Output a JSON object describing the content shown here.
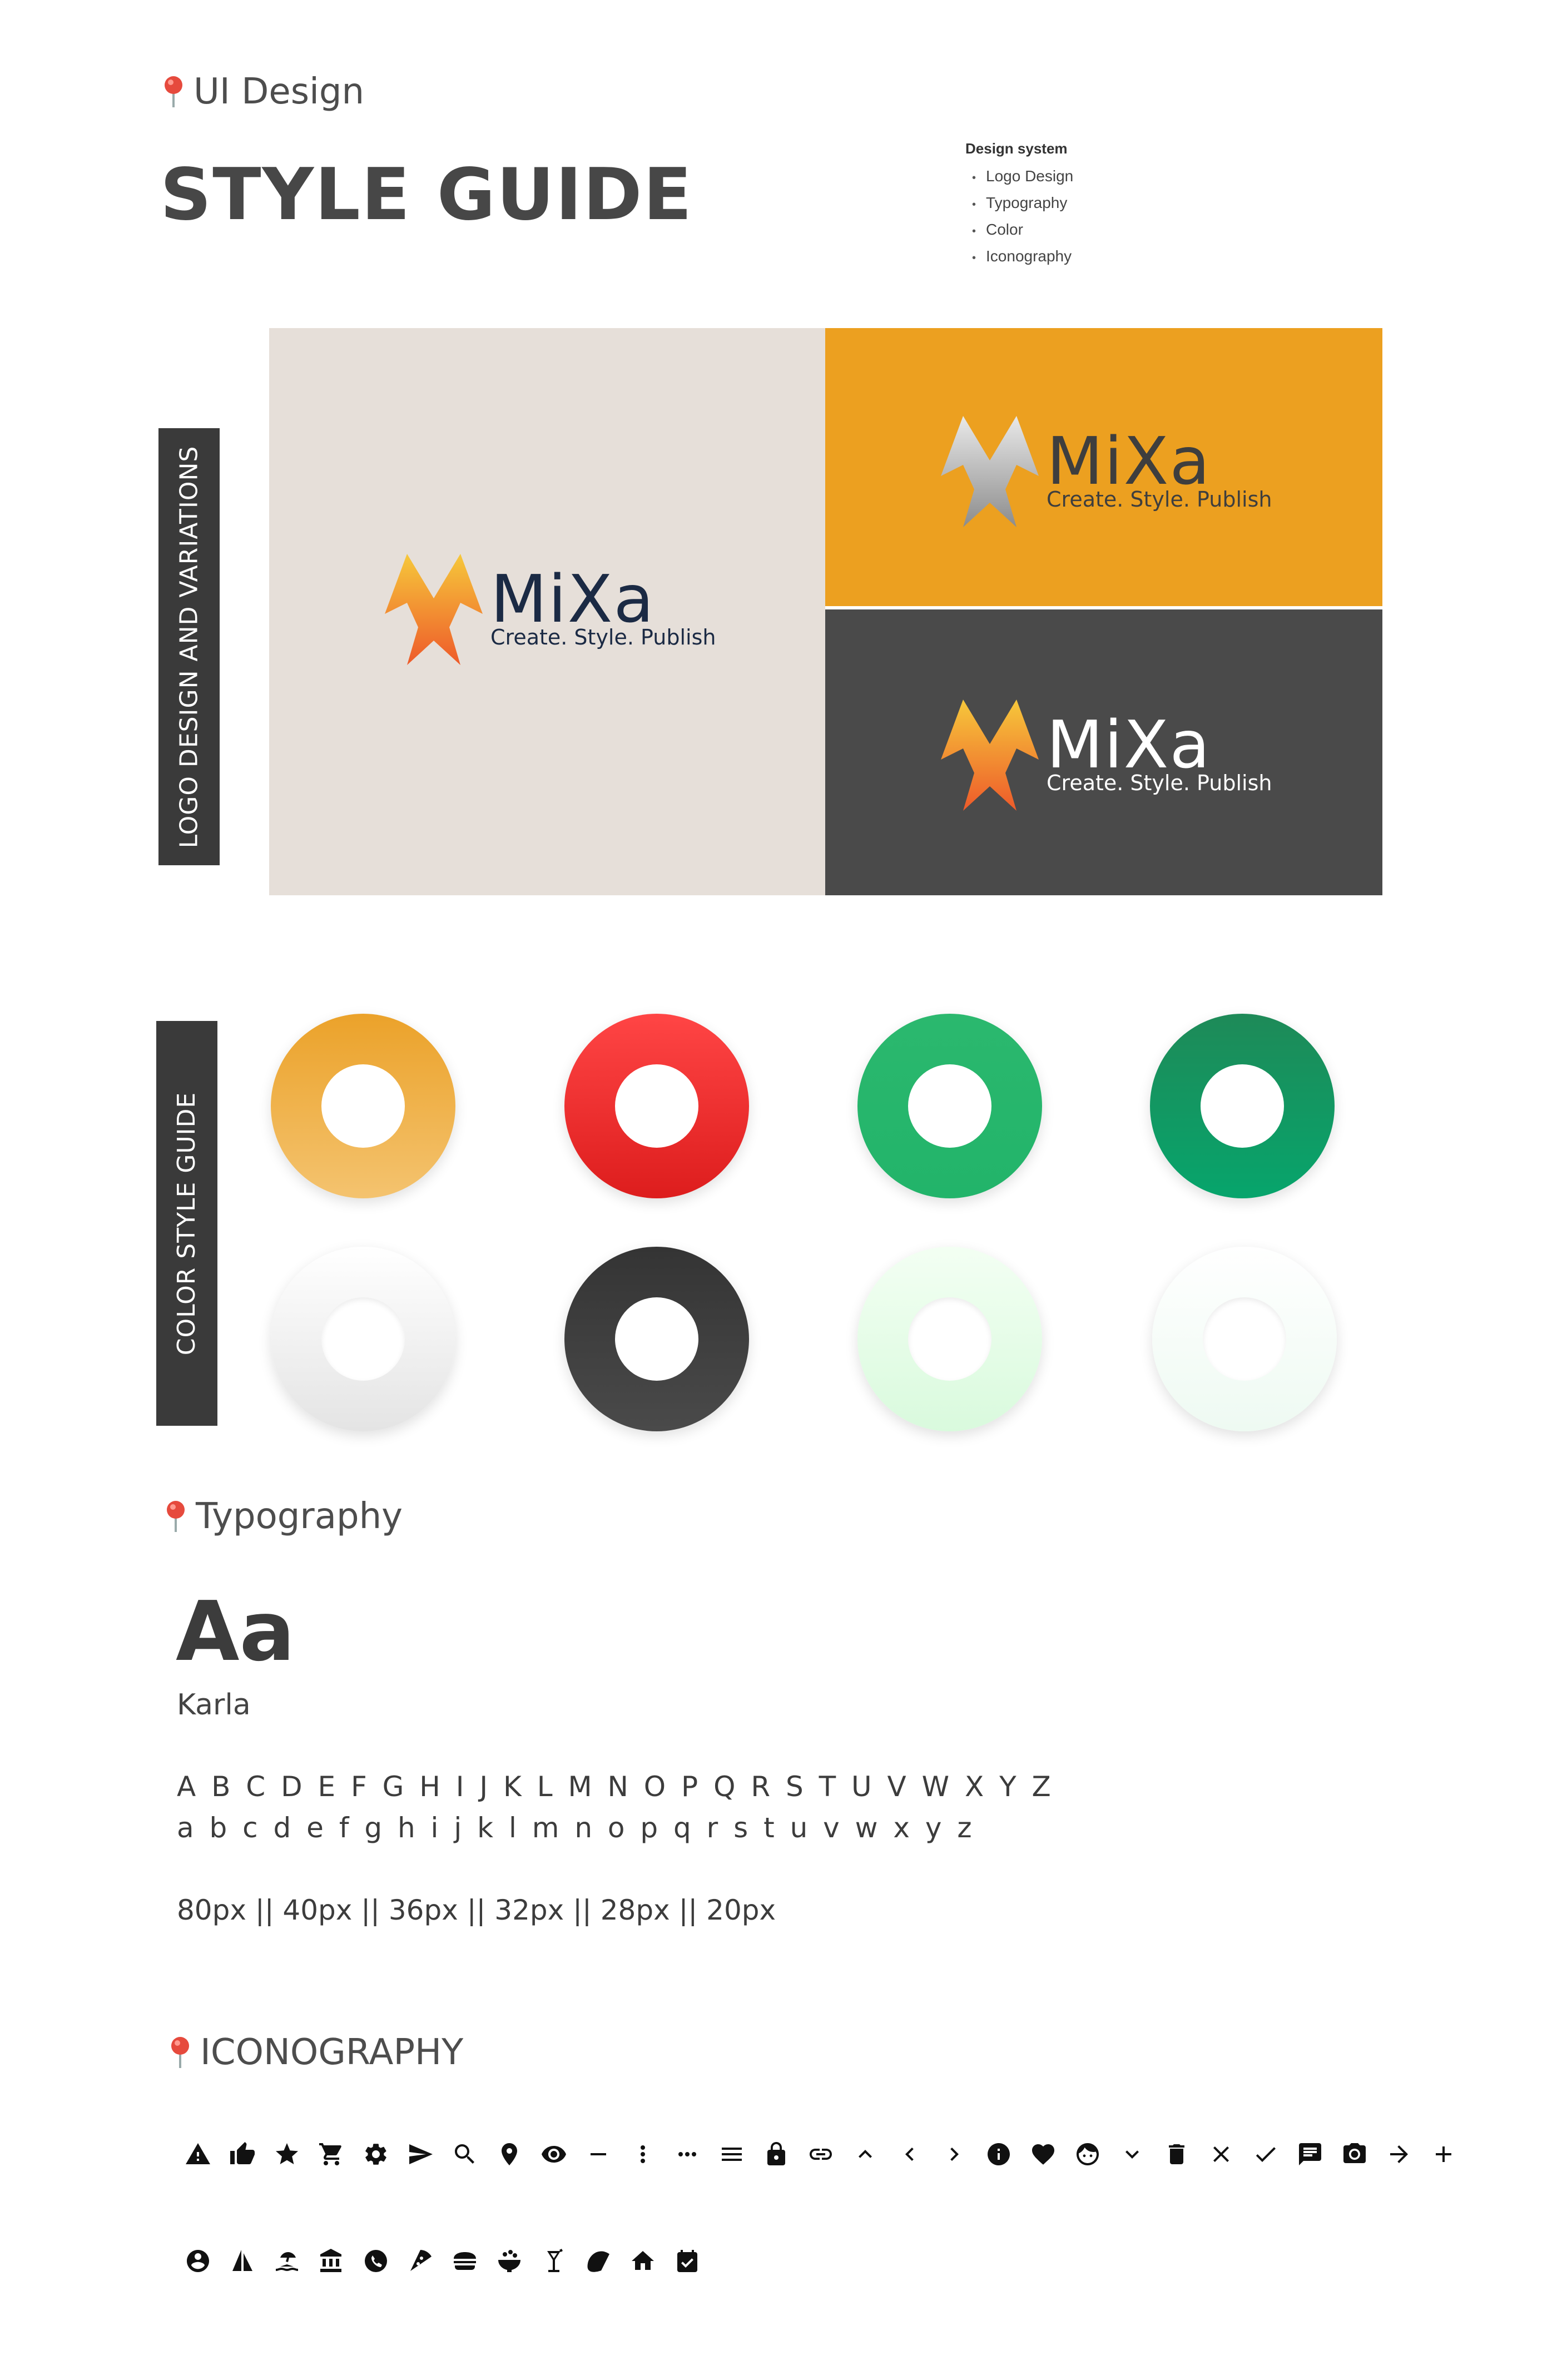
{
  "header": {
    "category": "UI Design",
    "title": "STYLE GUIDE"
  },
  "design_system": {
    "title": "Design system",
    "items": [
      "Logo Design",
      "Typography",
      "Color",
      "Iconography"
    ]
  },
  "logo_section": {
    "label": "LOGO DESIGN AND VARIATIONS",
    "brand_name": "MiXa",
    "tagline": "Create. Style. Publish",
    "variations": [
      {
        "background": "#e6dfd9",
        "text_color": "#1b2a44",
        "mark": "gold-orange"
      },
      {
        "background": "#eca020",
        "text_color": "#3e3e3e",
        "mark": "silver"
      },
      {
        "background": "#4a4a4a",
        "text_color": "#ffffff",
        "mark": "gold-orange"
      }
    ]
  },
  "color_section": {
    "label": "COLOR STYLE GUIDE",
    "swatches": [
      {
        "top": "#eba22a",
        "bottom": "#f4c36f"
      },
      {
        "top": "#ff4545",
        "bottom": "#dd1d1d"
      },
      {
        "top": "#2bb86e",
        "bottom": "#22b46a"
      },
      {
        "top": "#1e8a58",
        "bottom": "#07a56c"
      },
      {
        "top": "#ffffff",
        "bottom": "#e4e4e4"
      },
      {
        "top": "#343434",
        "bottom": "#4a4a4a"
      },
      {
        "top": "#f3fff3",
        "bottom": "#d9fadd"
      },
      {
        "top": "#ffffff",
        "bottom": "#eefaf2"
      }
    ]
  },
  "typography": {
    "heading": "Typography",
    "sample": "Aa",
    "font_name": "Karla",
    "uppercase": "A B C D E F G H I J K L M N O P Q R S T U V W X Y Z",
    "lowercase": "a b c d e f g h i j k l m n o p q r s t u v w x y z",
    "sizes": "80px || 40px || 36px || 32px || 28px || 20px"
  },
  "iconography": {
    "heading": "ICONOGRAPHY",
    "row1": [
      "warning-icon",
      "thumbs-up-icon",
      "star-icon",
      "cart-icon",
      "gear-icon",
      "send-icon",
      "search-icon",
      "location-pin-icon",
      "eye-icon",
      "minus-icon",
      "more-vertical-icon",
      "more-horizontal-icon",
      "menu-icon",
      "lock-icon",
      "link-icon",
      "chevron-up-icon",
      "chevron-left-icon",
      "chevron-right-icon",
      "info-icon",
      "heart-icon",
      "face-icon",
      "chevron-down-icon",
      "trash-icon",
      "close-icon",
      "check-icon",
      "chat-icon",
      "camera-icon",
      "arrow-right-icon",
      "plus-icon"
    ],
    "row2": [
      "account-circle-icon",
      "sailboat-icon",
      "beach-icon",
      "bank-icon",
      "phone-icon",
      "pizza-icon",
      "burger-icon",
      "bowl-icon",
      "cocktail-icon",
      "taco-icon",
      "home-icon",
      "calendar-check-icon"
    ]
  },
  "colors": {
    "heading_text": "#4d4d4d",
    "title_text": "#474747",
    "label_bg": "#3a3a3a",
    "pin": "#e64a3d"
  }
}
